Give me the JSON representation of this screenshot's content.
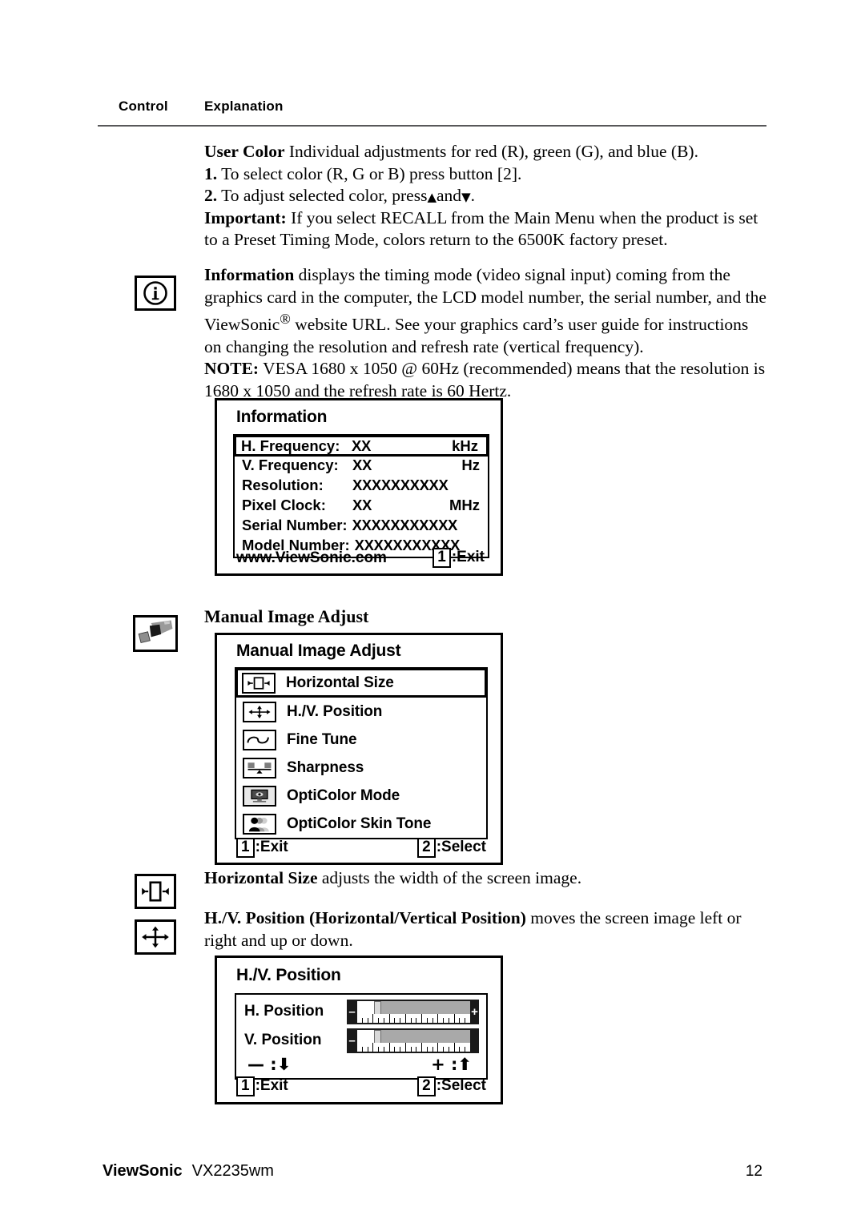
{
  "header": {
    "control_label": "Control",
    "explanation_label": "Explanation"
  },
  "sections": {
    "user_color": {
      "term": "User Color",
      "description": "  Individual adjustments for red (R), green (G),  and blue (B).",
      "step1_num": "1.",
      "step1_text": " To select color (R, G or B) press button [2].",
      "step2_num": "2.",
      "step2_text": " To adjust selected color, press",
      "step2_and": "and",
      "step2_end": ".",
      "important_term": "Important:",
      "important_text": " If you select RECALL from the Main Menu when the product is set to a Preset Timing Mode, colors return to the 6500K factory preset."
    },
    "information": {
      "term": "Information",
      "description": " displays the timing mode (video signal input) coming from the graphics card in the computer, the LCD model number, the serial number, and the ViewSonic",
      "registered_mark": "®",
      "description_cont": " website URL. See your graphics card’s user guide for instructions on changing the resolution and refresh rate (vertical frequency).",
      "note_term": "NOTE:",
      "note_text": " VESA 1680 x 1050 @ 60Hz (recommended) means that the resolution is 1680 x 1050 and the refresh rate is 60 Hertz.",
      "icon_name": "information-icon"
    },
    "manual_image_adjust": {
      "heading": "Manual Image Adjust",
      "icon_name": "manual-image-adjust-icon"
    },
    "horizontal_size": {
      "term": "Horizontal Size",
      "description": " adjusts the width of the screen image.",
      "icon_name": "horizontal-size-icon"
    },
    "hv_position": {
      "term": "H./V. Position (Horizontal/Vertical Position)",
      "description": " moves the screen image left or right and up or down.",
      "icon_name": "hv-position-icon"
    }
  },
  "osd_information": {
    "title": "Information",
    "rows": [
      {
        "label": "H. Frequency:",
        "value": "XX",
        "unit": "kHz",
        "selected": true
      },
      {
        "label": "V. Frequency:",
        "value": "XX",
        "unit": "Hz",
        "selected": false
      },
      {
        "label": "Resolution:",
        "value": "XXXXXXXXXX",
        "unit": "",
        "selected": false
      },
      {
        "label": "Pixel Clock:",
        "value": "XX",
        "unit": "MHz",
        "selected": false
      },
      {
        "label": "Serial Number:",
        "value": "XXXXXXXXXXX",
        "unit": "",
        "selected": false
      },
      {
        "label": "Model Number:",
        "value": "XXXXXXXXXXX",
        "unit": "",
        "selected": false
      }
    ],
    "footer_url": "www.ViewSonic.com",
    "footer_key": "1",
    "footer_action": ":Exit"
  },
  "osd_manual_image_adjust": {
    "title": "Manual Image Adjust",
    "items": [
      {
        "label": "Horizontal Size",
        "icon": "horizontal-size-icon",
        "selected": true
      },
      {
        "label": "H./V. Position",
        "icon": "hv-position-icon",
        "selected": false
      },
      {
        "label": "Fine Tune",
        "icon": "fine-tune-icon",
        "selected": false
      },
      {
        "label": "Sharpness",
        "icon": "sharpness-icon",
        "selected": false
      },
      {
        "label": "OptiColor Mode",
        "icon": "opticolor-mode-icon",
        "selected": false
      },
      {
        "label": "OptiColor Skin Tone",
        "icon": "opticolor-skin-tone-icon",
        "selected": false
      }
    ],
    "footer_exit_key": "1",
    "footer_exit_action": ":Exit",
    "footer_select_key": "2",
    "footer_select_action": ":Select"
  },
  "osd_hv_position": {
    "title": "H./V. Position",
    "rows": [
      {
        "label": "H. Position",
        "minus": "–",
        "plus": "+",
        "fill_percent": 16,
        "show_plus": true
      },
      {
        "label": "V. Position",
        "minus": "–",
        "plus": "+",
        "fill_percent": 16,
        "show_plus": false
      }
    ],
    "hint_minus": "— :",
    "hint_minus_arrow": "⬇",
    "hint_plus": "+ :",
    "hint_plus_arrow": "⬆",
    "footer_exit_key": "1",
    "footer_exit_action": ":Exit",
    "footer_select_key": "2",
    "footer_select_action": ":Select"
  },
  "footer": {
    "brand": "ViewSonic",
    "model": "VX2235wm",
    "page_number": "12"
  },
  "colors": {
    "text": "#000000",
    "rule": "#58585a",
    "slider_track": "#a9a9a9",
    "slider_bar_bg": "#1a1a1a",
    "icon_gray": "#9a9a9a"
  }
}
